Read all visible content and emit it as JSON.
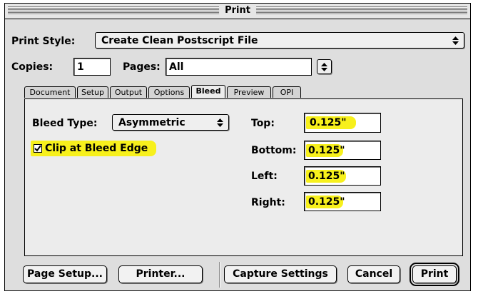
{
  "window": {
    "title": "Print"
  },
  "print_style": {
    "label": "Print Style:",
    "value": "Create Clean Postscript File"
  },
  "copies": {
    "label": "Copies:",
    "value": "1"
  },
  "pages": {
    "label": "Pages:",
    "value": "All"
  },
  "tabs": [
    {
      "label": "Document",
      "active": false
    },
    {
      "label": "Setup",
      "active": false
    },
    {
      "label": "Output",
      "active": false
    },
    {
      "label": "Options",
      "active": false
    },
    {
      "label": "Bleed",
      "active": true
    },
    {
      "label": "Preview",
      "active": false
    },
    {
      "label": "OPI",
      "active": false
    }
  ],
  "bleed": {
    "type_label": "Bleed Type:",
    "type_value": "Asymmetric",
    "clip_label": "Clip at Bleed Edge",
    "clip_checked": true,
    "top_label": "Top:",
    "top_value": "0.125\"",
    "bottom_label": "Bottom:",
    "bottom_value": "0.125\"",
    "left_label": "Left:",
    "left_value": "0.125\"",
    "right_label": "Right:",
    "right_value": "0.125\""
  },
  "buttons": {
    "page_setup": "Page Setup...",
    "printer": "Printer...",
    "capture_settings": "Capture Settings",
    "cancel": "Cancel",
    "print": "Print"
  },
  "colors": {
    "highlight": "#f7f01c",
    "window_bg": "#dedede"
  }
}
